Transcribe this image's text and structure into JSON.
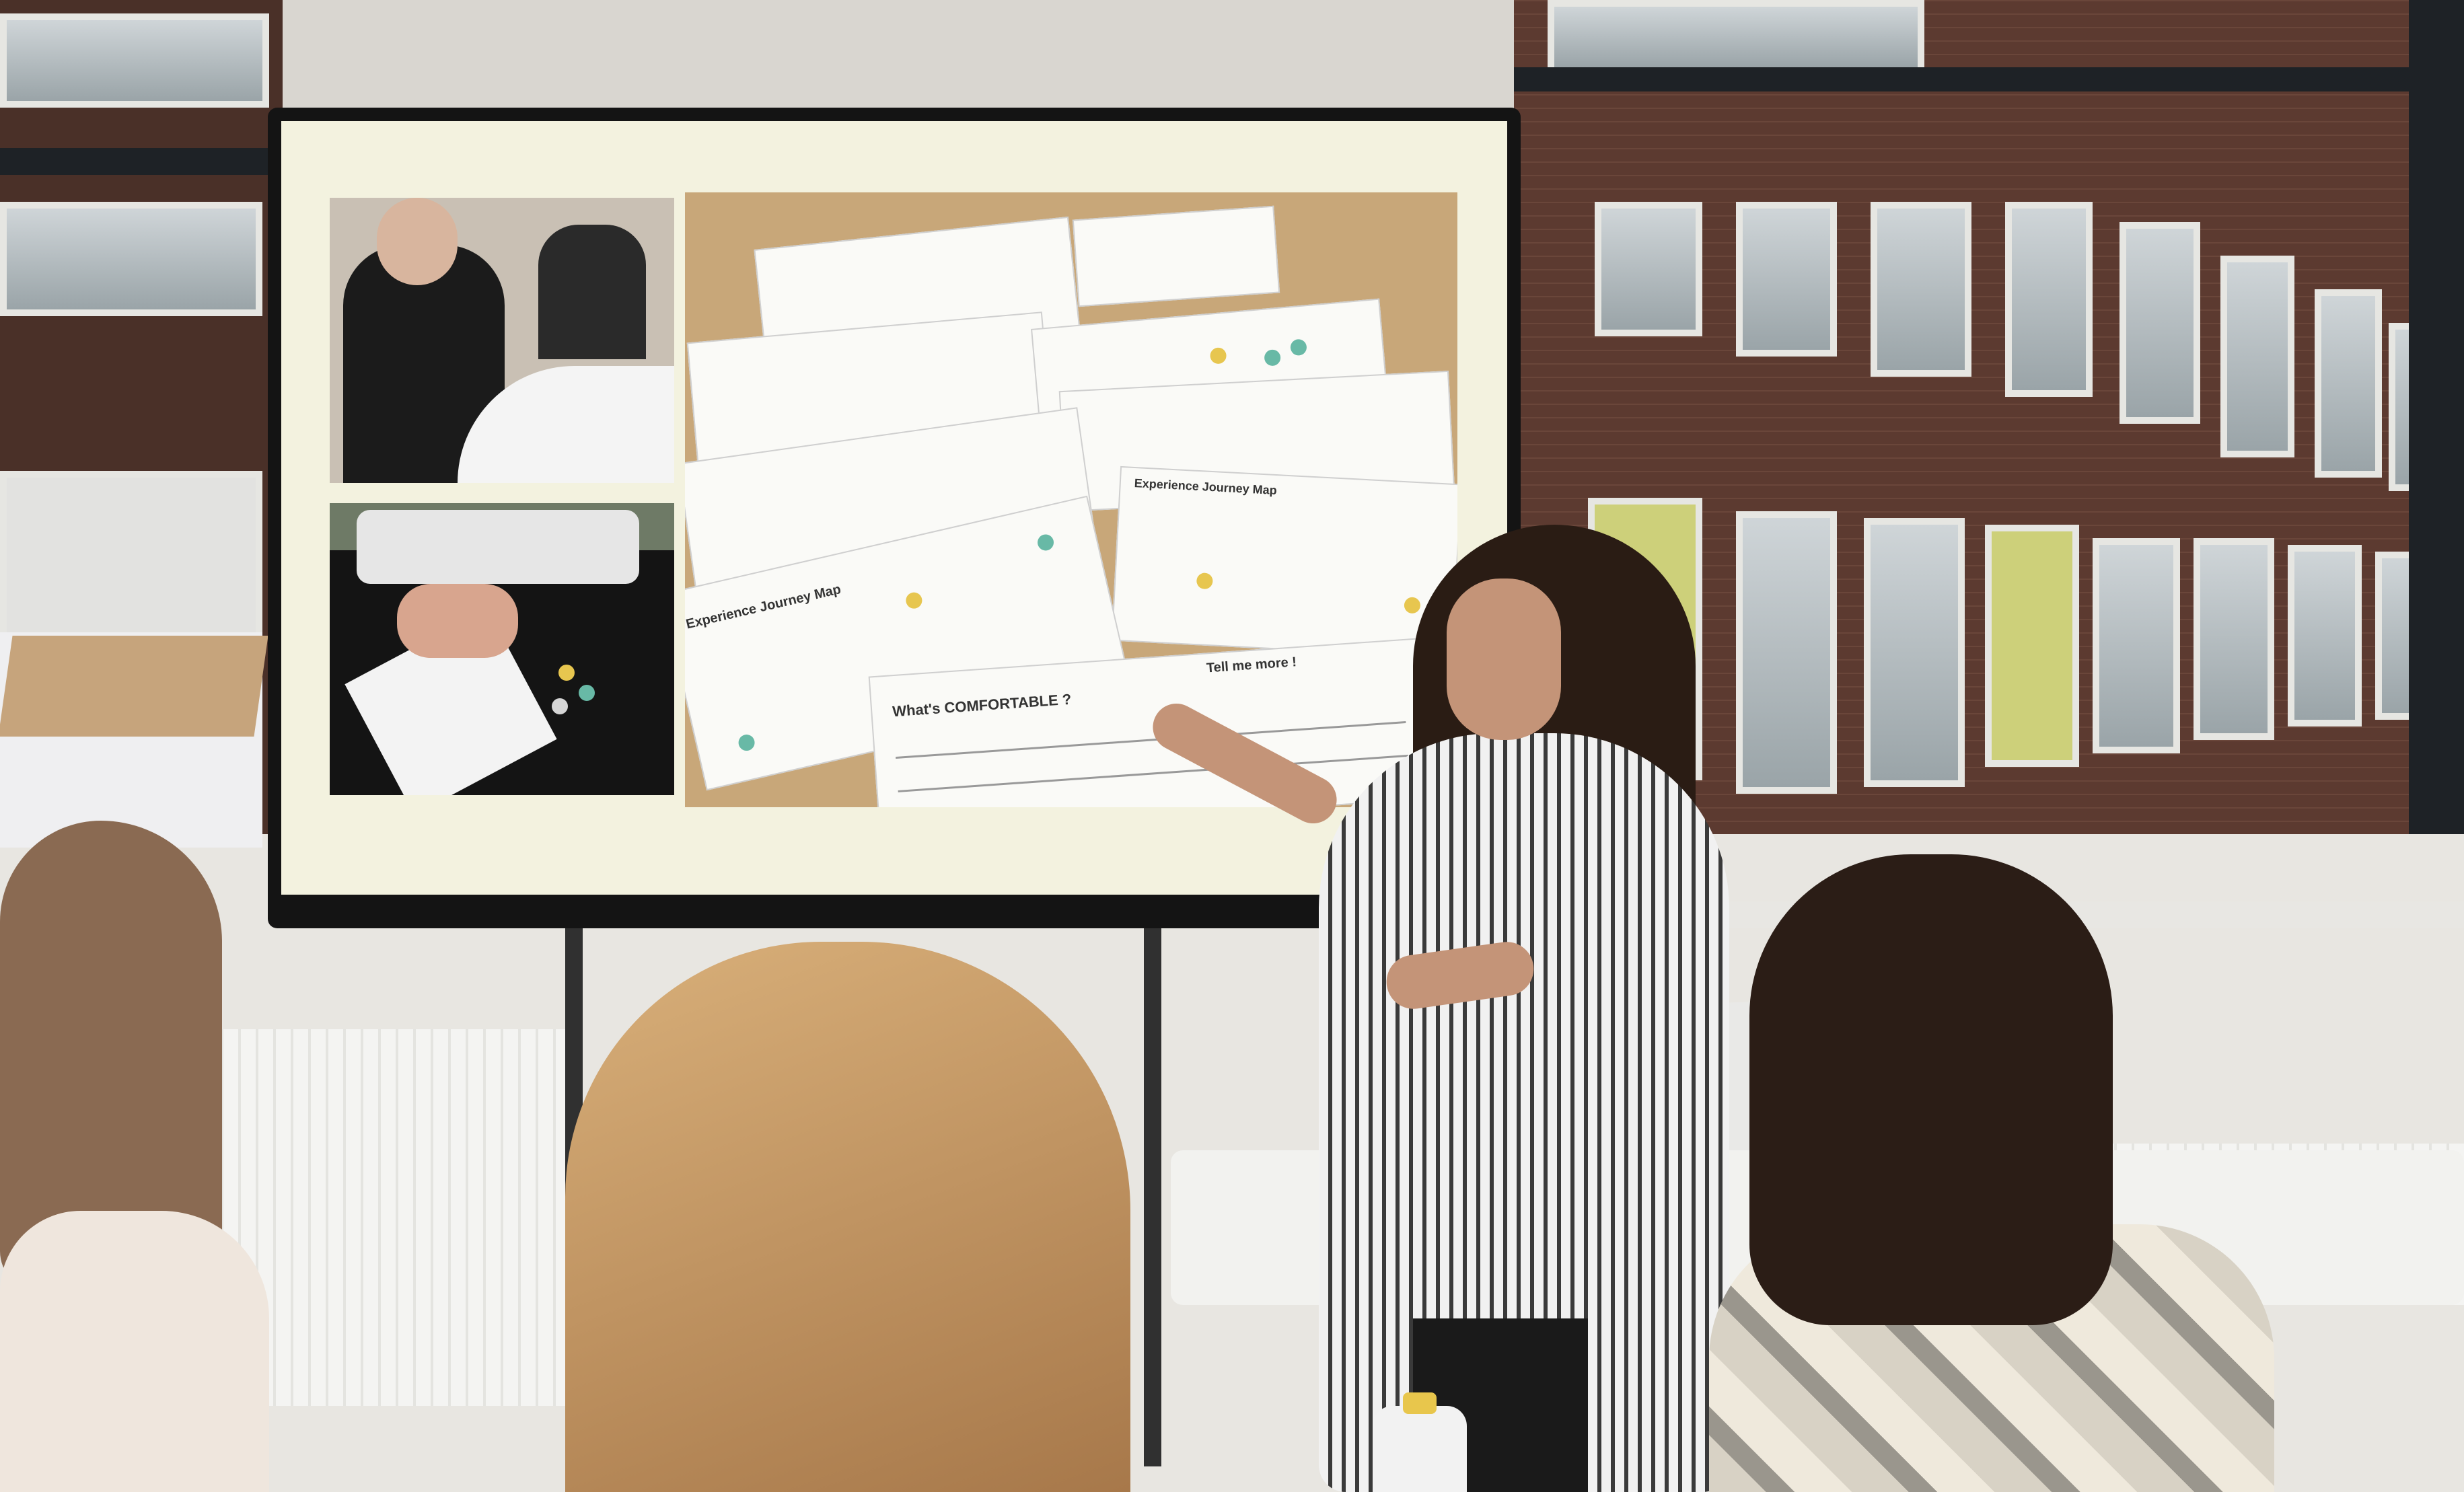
{
  "scene": {
    "description_colors": {
      "wall": "#d9d6d0",
      "screen_bg": "#f3f2df",
      "brick": "#5c3a30"
    }
  },
  "slide": {
    "sheets": {
      "journey_map_1": "Experience Journey Map",
      "journey_map_2": "Experience Journey Map",
      "comfortable": "What's COMFORTABLE ?",
      "tell_more": "Tell me more !"
    }
  }
}
